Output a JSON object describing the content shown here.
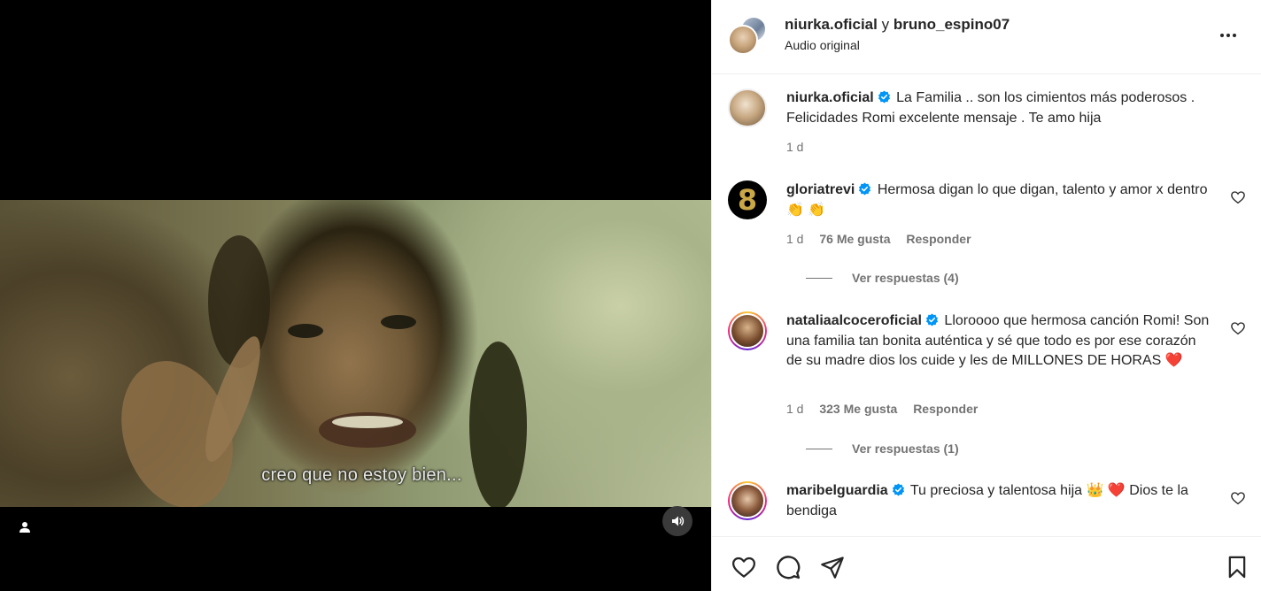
{
  "video": {
    "subtitle": "creo que no estoy bien..."
  },
  "header": {
    "author": "niurka.oficial",
    "connector": "y",
    "collaborator": "bruno_espino07",
    "audio": "Audio original"
  },
  "caption": {
    "username": "niurka.oficial",
    "text": "La Familia .. son los cimientos más poderosos . Felicidades Romi excelente mensaje . Te amo hija",
    "time": "1 d"
  },
  "comments": [
    {
      "username": "gloriatrevi",
      "text": "Hermosa digan lo que digan, talento y amor x dentro 👏 👏",
      "time": "1 d",
      "likes": "76 Me gusta",
      "reply": "Responder",
      "view_replies": "Ver respuestas (4)",
      "avatar_glyph": "8"
    },
    {
      "username": "nataliaalcoceroficial",
      "text": "Lloroooo que hermosa canción Romi! Son una familia tan bonita auténtica y sé que todo es por ese corazón de su madre dios los cuide y les de MILLONES DE HORAS ❤️",
      "time": "1 d",
      "likes": "323 Me gusta",
      "reply": "Responder",
      "view_replies": "Ver respuestas (1)"
    },
    {
      "username": "maribelguardia",
      "text": "Tu preciosa y talentosa hija 👑 ❤️  Dios te la bendiga"
    }
  ],
  "colors": {
    "verified": "#0095f6",
    "text": "#262626",
    "secondary": "#737373"
  },
  "icons": {
    "more": "more-horizontal-icon",
    "mute": "speaker-icon",
    "user_tag": "user-icon",
    "like": "heart-icon",
    "comment": "comment-icon",
    "share": "paper-plane-icon",
    "save": "bookmark-icon"
  }
}
